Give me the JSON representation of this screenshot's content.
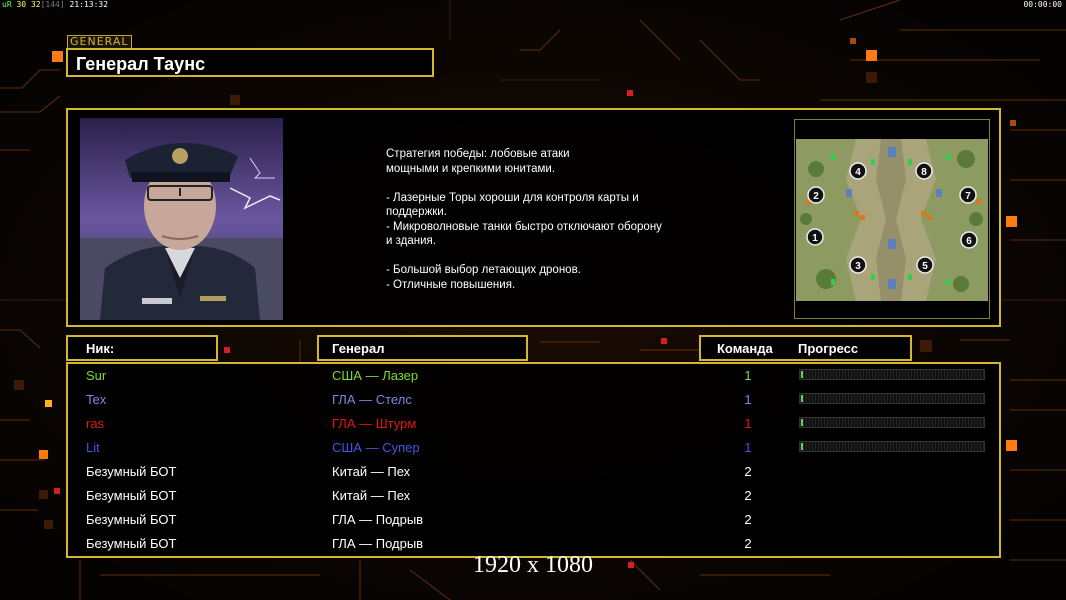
{
  "hud": {
    "left_a": "uR",
    "left_b": "30",
    "left_c": "32",
    "left_d": "[144]",
    "left_time": "21:13:32",
    "right_time": "00:00:00"
  },
  "general": {
    "tag": "GENERAL",
    "name": "Генерал Таунс",
    "description": "Стратегия победы: лобовые атаки\nмощными и крепкими юнитами.\n\n- Лазерные Торы хороши для контроля карты и\n  поддержки.\n- Микроволновые танки быстро отключают оборону\n  и здания.\n\n- Большой выбор летающих дронов.\n- Отличные повышения."
  },
  "map": {
    "start_positions": [
      "4",
      "8",
      "2",
      "7",
      "1",
      "6",
      "3",
      "5"
    ]
  },
  "table": {
    "col_nick": "Ник:",
    "col_general": "Генерал",
    "col_team": "Команда",
    "col_progress": "Прогресс",
    "players": [
      {
        "nick": "Sur",
        "faction": "США — Лазер",
        "team": "1",
        "color": "#7ddc2e",
        "progress": 0.01,
        "has_bar": true
      },
      {
        "nick": "Tex",
        "faction": "ГЛА — Стелс",
        "team": "1",
        "color": "#7f86e8",
        "progress": 0,
        "has_bar": true
      },
      {
        "nick": "ras",
        "faction": "ГЛА — Штурм",
        "team": "1",
        "color": "#e01616",
        "progress": 0,
        "has_bar": true
      },
      {
        "nick": "Lit",
        "faction": "США — Супер",
        "team": "1",
        "color": "#3f58e4",
        "progress": 0,
        "has_bar": true
      },
      {
        "nick": "Безумный БОТ",
        "faction": "Китай — Пех",
        "team": "2",
        "color": "#ffffff",
        "progress": 0,
        "has_bar": false
      },
      {
        "nick": "Безумный БОТ",
        "faction": "Китай — Пех",
        "team": "2",
        "color": "#ffffff",
        "progress": 0,
        "has_bar": false
      },
      {
        "nick": "Безумный БОТ",
        "faction": "ГЛА — Подрыв",
        "team": "2",
        "color": "#ffffff",
        "progress": 0,
        "has_bar": false
      },
      {
        "nick": "Безумный БОТ",
        "faction": "ГЛА — Подрыв",
        "team": "2",
        "color": "#ffffff",
        "progress": 0,
        "has_bar": false
      }
    ]
  },
  "resolution": "1920 x 1080",
  "colors": {
    "frame": "#d3b72c",
    "accent_orange": "#ff8a12",
    "background": "#050302"
  }
}
